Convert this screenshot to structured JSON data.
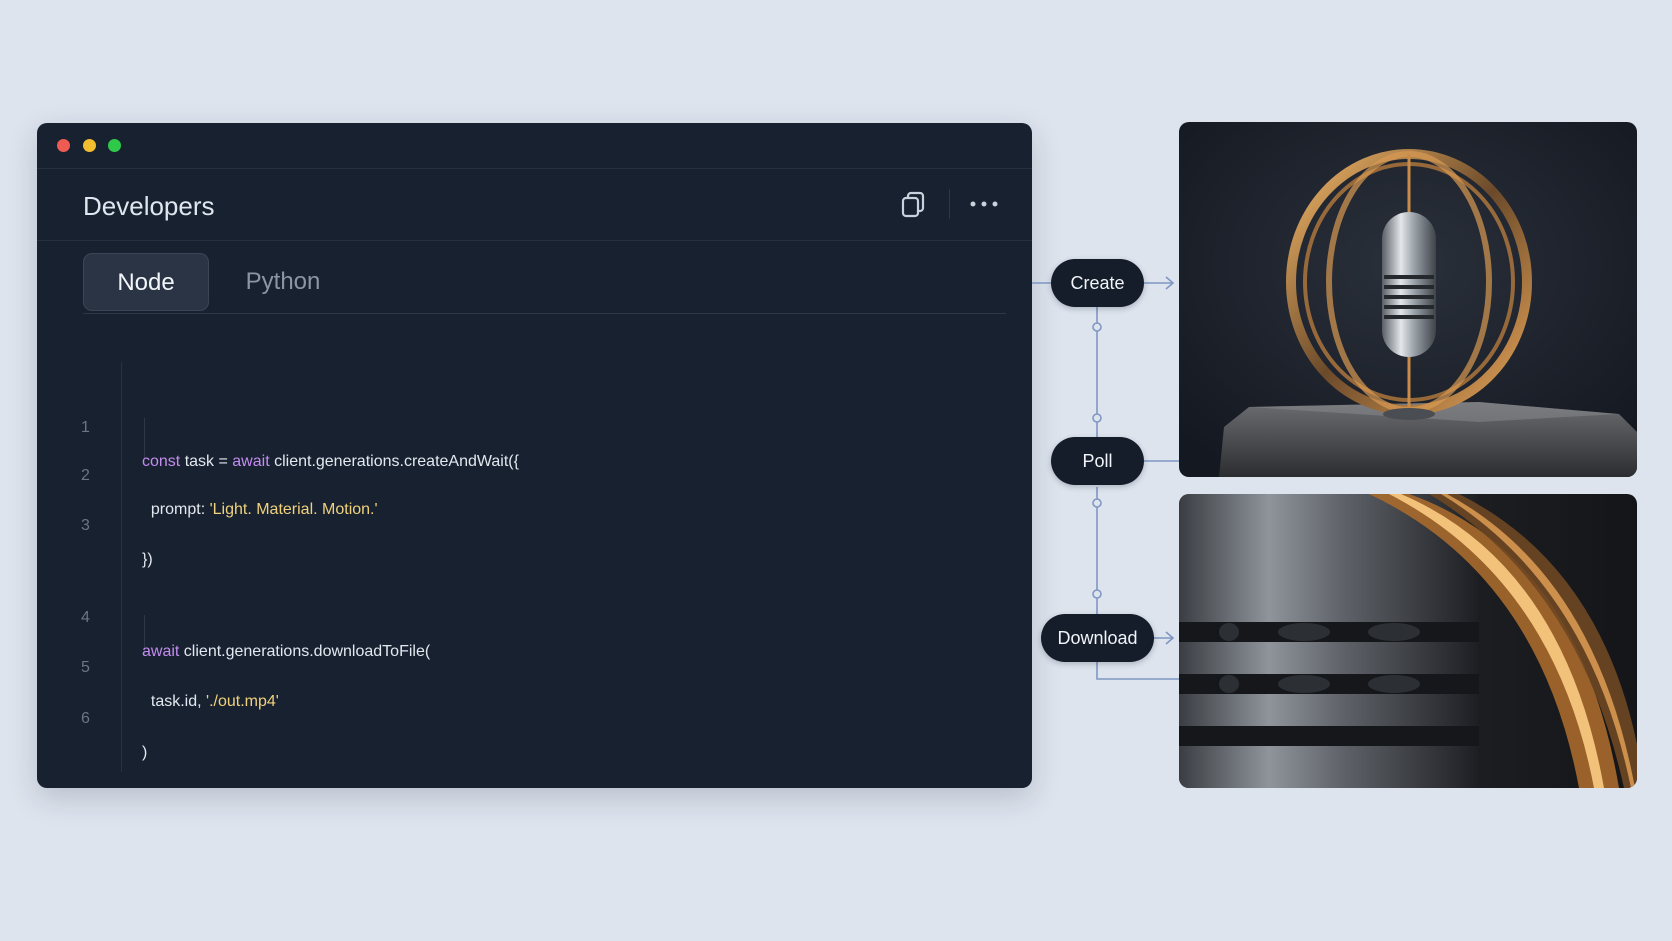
{
  "window": {
    "title": "Developers",
    "tabs": [
      {
        "label": "Node",
        "active": true
      },
      {
        "label": "Python",
        "active": false
      }
    ]
  },
  "code": {
    "lines": [
      {
        "num": "1",
        "parts": [
          {
            "t": "const",
            "k": "kw"
          },
          {
            "t": " task = ",
            "k": "p"
          },
          {
            "t": "await",
            "k": "kw"
          },
          {
            "t": " client.generations.createAndWait({",
            "k": "p"
          }
        ]
      },
      {
        "num": "2",
        "parts": [
          {
            "t": "  prompt: ",
            "k": "p"
          },
          {
            "t": "'Light. Material. Motion.'",
            "k": "str"
          }
        ]
      },
      {
        "num": "3",
        "parts": [
          {
            "t": "})",
            "k": "p"
          }
        ]
      },
      {
        "num": "4",
        "parts": [
          {
            "t": "await",
            "k": "kw"
          },
          {
            "t": " client.generations.downloadToFile(",
            "k": "p"
          }
        ]
      },
      {
        "num": "5",
        "parts": [
          {
            "t": "  task.id, ",
            "k": "p"
          },
          {
            "t": "'./out.mp4'",
            "k": "str"
          }
        ]
      },
      {
        "num": "6",
        "parts": [
          {
            "t": ")",
            "k": "p"
          }
        ]
      }
    ]
  },
  "flow": {
    "steps": [
      "Create",
      "Poll",
      "Download"
    ]
  },
  "icons": {
    "copy": "copy-icon",
    "more": "more-horizontal-icon",
    "arrow": "arrow-right-icon"
  },
  "colors": {
    "background": "#dde4ee",
    "window": "#182130",
    "keyword": "#c38cf0",
    "string": "#f0d27c",
    "pill": "#151d2a"
  }
}
